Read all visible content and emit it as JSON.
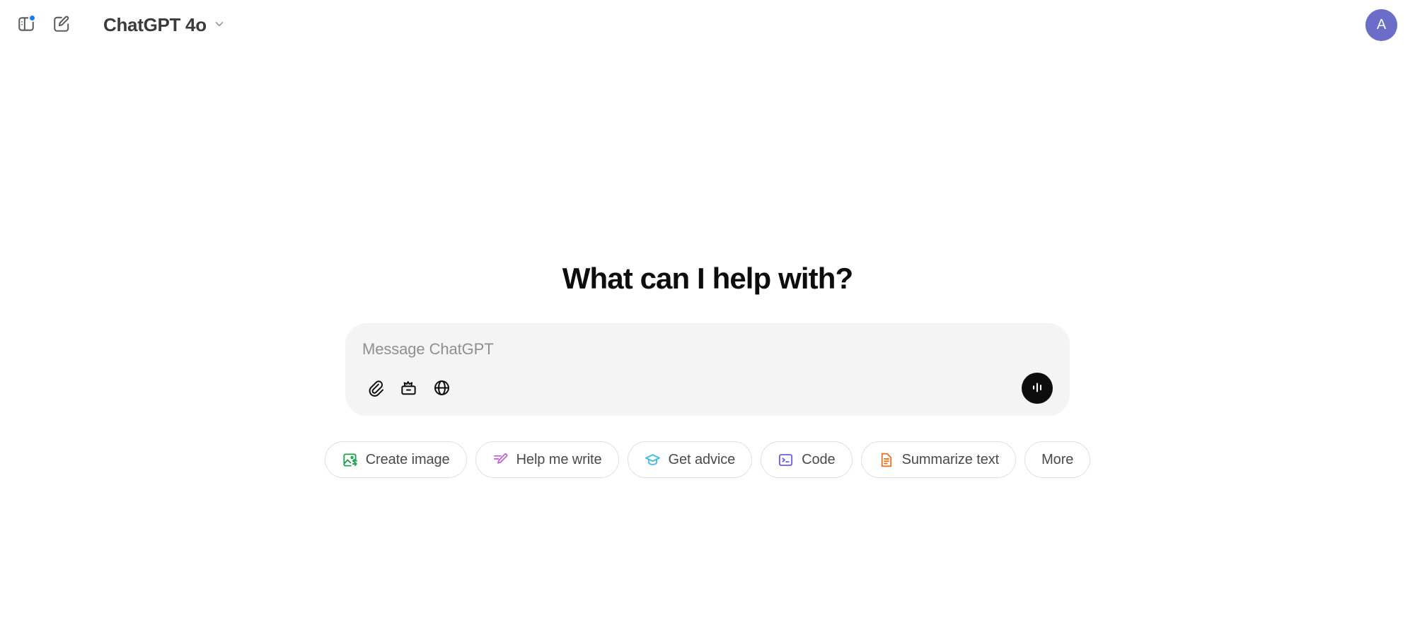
{
  "topbar": {
    "sidebar_toggle": {
      "icon": "sidebar-panel-icon",
      "has_badge": true,
      "badge_color": "#1a7aff"
    },
    "new_chat": {
      "icon": "new-chat-pencil-icon"
    },
    "model_name": "ChatGPT 4o",
    "model_chevron_icon": "chevron-down-icon",
    "avatar_initial": "A",
    "avatar_color": "#6a6ec9"
  },
  "main": {
    "headline": "What can I help with?"
  },
  "composer": {
    "placeholder": "Message ChatGPT",
    "background": "#f4f4f4",
    "tools": [
      {
        "name": "attach-file",
        "icon": "paperclip-icon"
      },
      {
        "name": "tools",
        "icon": "toolbox-icon"
      },
      {
        "name": "search-web",
        "icon": "globe-icon"
      }
    ],
    "voice_button": {
      "name": "voice-mode",
      "icon": "waveform-icon",
      "color": "#0d0d0d"
    }
  },
  "chips": [
    {
      "label": "Create image",
      "icon": "image-icon",
      "color": "#19a34a"
    },
    {
      "label": "Help me write",
      "icon": "pencil-lines-icon",
      "color": "#c164d4"
    },
    {
      "label": "Get advice",
      "icon": "graduation-cap-icon",
      "color": "#43b9e8"
    },
    {
      "label": "Code",
      "icon": "terminal-icon",
      "color": "#6b5ce7"
    },
    {
      "label": "Summarize text",
      "icon": "document-lines-icon",
      "color": "#f0711a"
    },
    {
      "label": "More",
      "icon": null,
      "color": null
    }
  ]
}
